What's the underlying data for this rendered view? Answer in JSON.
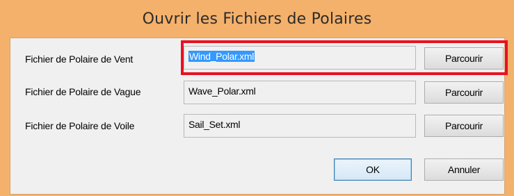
{
  "window": {
    "title": "Ouvrir les Fichiers de Polaires"
  },
  "rows": [
    {
      "label": "Fichier de Polaire de Vent",
      "value": "Wind_Polar.xml",
      "selected": true,
      "button": "Parcourir"
    },
    {
      "label": "Fichier de Polaire de Vague",
      "value": "Wave_Polar.xml",
      "selected": false,
      "button": "Parcourir"
    },
    {
      "label": "Fichier de Polaire de Voile",
      "value": "Sail_Set.xml",
      "selected": false,
      "button": "Parcourir"
    }
  ],
  "footer": {
    "ok_label": "OK",
    "cancel_label": "Annuler"
  },
  "colors": {
    "titlebar": "#f4b16b",
    "selection": "#3399ff",
    "highlight_box": "#e81123"
  }
}
